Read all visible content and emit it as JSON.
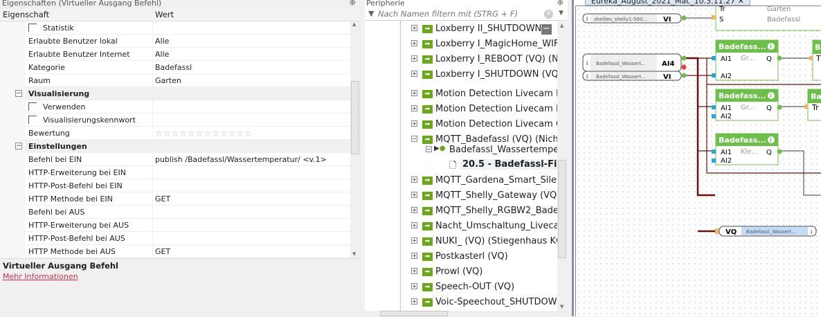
{
  "properties": {
    "title": "Eigenschaften (Virtueller Ausgang Befehl)",
    "col_property": "Eigenschaft",
    "col_value": "Wert",
    "rows": [
      {
        "k": "Statistik",
        "v": ""
      },
      {
        "k": "Erlaubte Benutzer lokal",
        "v": "Alle"
      },
      {
        "k": "Erlaubte Benutzer Internet",
        "v": "Alle"
      },
      {
        "k": "Kategorie",
        "v": "Badefassl"
      },
      {
        "k": "Raum",
        "v": "Garten"
      },
      {
        "k": "Visualisierung",
        "v": ""
      },
      {
        "k": "Verwenden",
        "v": ""
      },
      {
        "k": "Visualisierungskennwort",
        "v": ""
      },
      {
        "k": "Bewertung",
        "v": "☆☆☆☆☆☆☆☆☆☆☆☆"
      },
      {
        "k": "Einstellungen",
        "v": ""
      },
      {
        "k": "Befehl bei EIN",
        "v": "publish /Badefassl/Wassertemperatur/ <v.1>"
      },
      {
        "k": "HTTP-Erweiterung bei EIN",
        "v": ""
      },
      {
        "k": "HTTP-Post-Befehl bei EIN",
        "v": ""
      },
      {
        "k": "HTTP Methode bei EIN",
        "v": "GET"
      },
      {
        "k": "Befehl bei AUS",
        "v": ""
      },
      {
        "k": "HTTP-Erweiterung bei AUS",
        "v": ""
      },
      {
        "k": "HTTP-Post-Befehl bei AUS",
        "v": ""
      },
      {
        "k": "HTTP Methode bei AUS",
        "v": "GET"
      }
    ],
    "rating": 0,
    "desc_title": "Virtueller Ausgang Befehl",
    "desc_link": "Mehr Informationen"
  },
  "periphery": {
    "title": "Peripherie",
    "filter_placeholder": "Nach Namen filtern mit (STRG + F)",
    "items": [
      "Loxberry II_SHUTDOWN",
      "Loxberry I_MagicHome_WIF",
      "Loxberry I_REBOOT (VQ) (Ni",
      "Loxberry I_SHUTDOWN (VQ",
      "Motion Detection Livecam E",
      "Motion Detection Livecam E",
      "Motion Detection Livecam G",
      "MQTT_Badefassl (VQ) (Nicht"
    ],
    "child": "Badefassl_Wassertemper",
    "grandchild": "20.5 - Badefassl-Filt",
    "items2": [
      "MQTT_Gardena_Smart_Silen",
      "MQTT_Shelly_Gateway (VQ)",
      "MQTT_Shelly_RGBW2_Badef",
      "Nacht_Umschaltung_Livecar",
      "NUKI_ (VQ) (Stiegenhaus KG",
      "Postkasterl (VQ)",
      "Prowl (VQ)",
      "Speech-OUT (VQ)",
      "Voic-Speechout_SHUTDOW"
    ]
  },
  "diagram": {
    "tab": "Eureka_August_2021_Mac_10.3.11.27",
    "inputs": [
      {
        "name": "shellies_shelly1-500...",
        "type": "VI"
      },
      {
        "name": "Badefassl_Wassert...",
        "type": "AI4"
      },
      {
        "name": "Badefassl_Wassert...",
        "type": "VI"
      }
    ],
    "top_block": {
      "t": "Tr",
      "s": "S",
      "room": "Garten",
      "cat": "Badefassl"
    },
    "blocks": [
      {
        "title": "Badefass...",
        "in1": "AI1",
        "in2": "AI2",
        "mid": "Gr...",
        "out": "Q"
      },
      {
        "title": "Badefass...",
        "in1": "AI1",
        "in2": "AI2",
        "mid": "Gr...",
        "out": "Q"
      },
      {
        "title": "Badefass...",
        "in1": "AI1",
        "in2": "AI2",
        "mid": "Kle...",
        "out": "Q"
      }
    ],
    "right_blocks": [
      {
        "title": "Ba",
        "in": "T"
      },
      {
        "title": "Bad",
        "in": "Tr"
      }
    ],
    "output": {
      "type": "VQ",
      "name": "Badefassl_Wassert..."
    },
    "info": "i"
  }
}
